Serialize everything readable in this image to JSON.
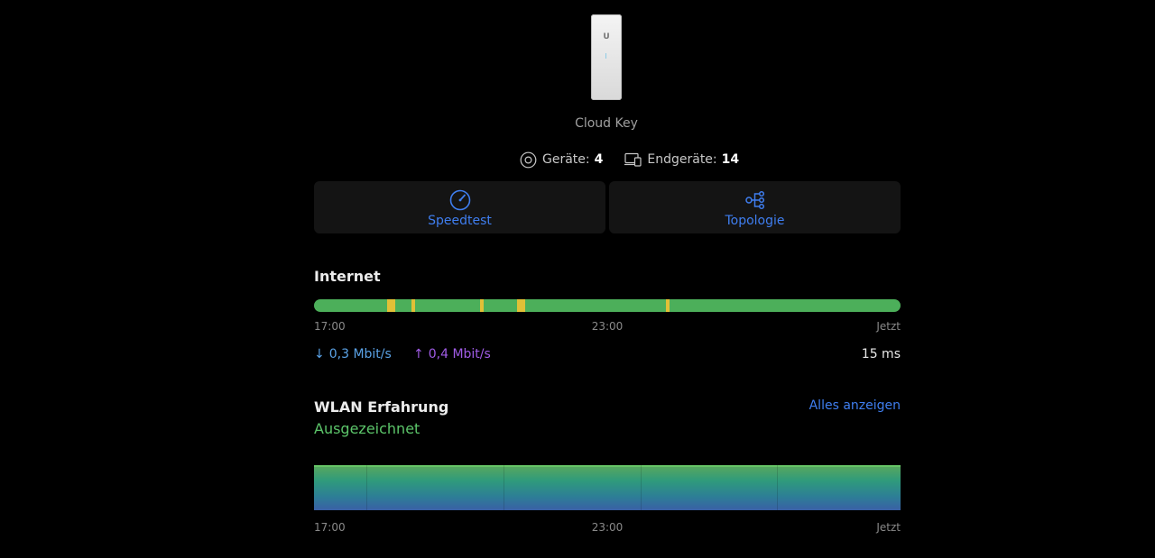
{
  "device": {
    "name": "Cloud Key",
    "logo": "U",
    "image_icon": "cloud-key-device-icon"
  },
  "counts": {
    "devices_label": "Geräte:",
    "devices_value": "4",
    "devices_icon": "device-ring-icon",
    "clients_label": "Endgeräte:",
    "clients_value": "14",
    "clients_icon": "client-devices-icon"
  },
  "actions": {
    "speedtest_label": "Speedtest",
    "speedtest_icon": "speedometer-icon",
    "topology_label": "Topologie",
    "topology_icon": "topology-icon"
  },
  "internet": {
    "title": "Internet",
    "ticks": [
      "17:00",
      "23:00",
      "Jetzt"
    ],
    "down_arrow": "↓",
    "down_rate": "0,3 Mbit/s",
    "up_arrow": "↑",
    "up_rate": "0,4 Mbit/s",
    "latency": "15 ms",
    "colors": {
      "ok": "#4caf5a",
      "warn": "#e1c037",
      "down": "#5aa2e6",
      "up": "#a05ce6"
    }
  },
  "wlan": {
    "title": "WLAN Erfahrung",
    "status": "Ausgezeichnet",
    "view_all": "Alles anzeigen",
    "ticks": [
      "17:00",
      "23:00",
      "Jetzt"
    ]
  },
  "colors": {
    "accent": "#3f7ef0",
    "good": "#5cc56a"
  }
}
